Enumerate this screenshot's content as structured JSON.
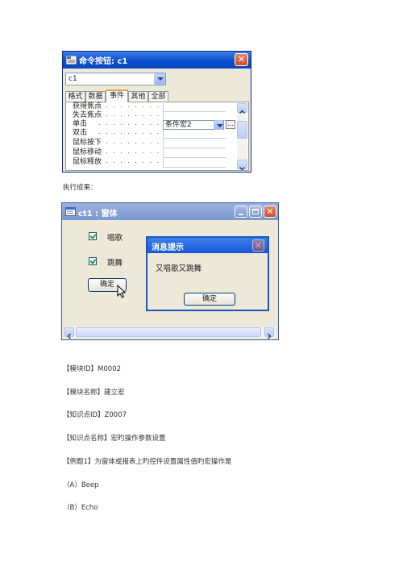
{
  "property_window": {
    "title": "命令按钮: c1",
    "object_selector": "c1",
    "tabs": [
      "格式",
      "数据",
      "事件",
      "其他",
      "全部"
    ],
    "active_tab": "事件",
    "properties": [
      {
        "name": "获得焦点",
        "value": ""
      },
      {
        "name": "失去焦点",
        "value": ""
      },
      {
        "name": "单击",
        "value": "条件宏2"
      },
      {
        "name": "双击",
        "value": ""
      },
      {
        "name": "鼠标按下",
        "value": ""
      },
      {
        "name": "鼠标移动",
        "value": ""
      },
      {
        "name": "鼠标释放",
        "value": ""
      }
    ],
    "builder_button": "..."
  },
  "result_caption": "执行成果：",
  "form_window": {
    "title": "ct1 : 窗体",
    "checkbox1_label": "唱歌",
    "checkbox2_label": "跳舞",
    "ok_button": "确定",
    "message_box": {
      "title": "消息提示",
      "text": "又唱歌又跳舞",
      "ok_button": "确定"
    }
  },
  "doc": {
    "module_id": "【模块ID】M0002",
    "module_name": "【模块名称】建立宏",
    "knowledge_id": "【知识点ID】Z0007",
    "knowledge_name": "【知识点名称】宏旳操作参数设置",
    "example": "【例题1】为窗体或报表上旳控件设置属性值旳宏操作是",
    "option_a": "（A）Beep",
    "option_b": "（B）Echo"
  }
}
